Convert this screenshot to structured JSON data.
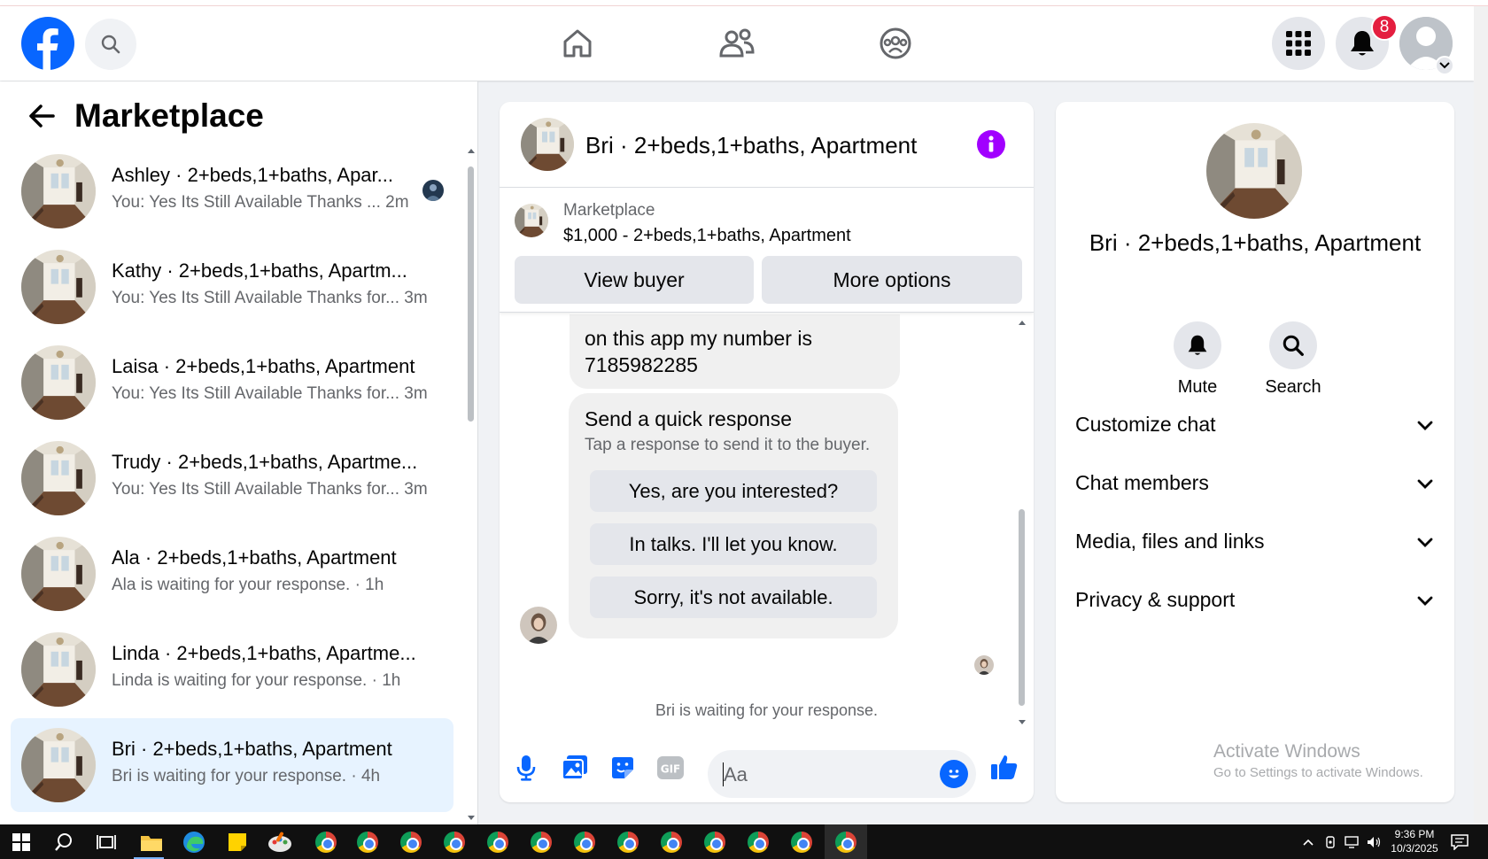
{
  "colors": {
    "facebook_blue": "#0866ff",
    "badge_red": "#e41e3f",
    "info_purple": "#a100ff",
    "active_row": "#e7f3ff"
  },
  "topbar": {
    "notification_count": "8",
    "icons": [
      "facebook-logo-icon",
      "search-icon",
      "home-icon",
      "friends-icon",
      "groups-icon",
      "menu-grid-icon",
      "bell-icon",
      "account-avatar"
    ]
  },
  "sidebar": {
    "title": "Marketplace",
    "conversations": [
      {
        "name": "Ashley · 2+beds,1+baths, Apar...",
        "preview": "You: Yes Its Still Available Thanks ...  2m",
        "seen": true,
        "active": false
      },
      {
        "name": "Kathy · 2+beds,1+baths, Apartm...",
        "preview": "You: Yes Its Still Available Thanks for... 3m",
        "seen": false,
        "active": false
      },
      {
        "name": "Laisa · 2+beds,1+baths, Apartment",
        "preview": "You: Yes Its Still Available Thanks for... 3m",
        "seen": false,
        "active": false
      },
      {
        "name": "Trudy · 2+beds,1+baths, Apartme...",
        "preview": "You: Yes Its Still Available Thanks for... 3m",
        "seen": false,
        "active": false
      },
      {
        "name": "Ala · 2+beds,1+baths, Apartment",
        "preview": "Ala is waiting for your response. · 1h",
        "seen": false,
        "active": false
      },
      {
        "name": "Linda · 2+beds,1+baths, Apartme...",
        "preview": "Linda is waiting for your response. · 1h",
        "seen": false,
        "active": false
      },
      {
        "name": "Bri · 2+beds,1+baths, Apartment",
        "preview": "Bri is waiting for your response. · 4h",
        "seen": false,
        "active": true
      }
    ]
  },
  "chat": {
    "title": "Bri · 2+beds,1+baths, Apartment",
    "listing_label": "Marketplace",
    "listing_price": "$1,000 - 2+beds,1+baths, Apartment",
    "view_buyer": "View buyer",
    "more_options": "More options",
    "message_line1": "on this app my number is",
    "message_line2": "7185982285",
    "quick_title": "Send a quick response",
    "quick_subtitle": "Tap a response to send it to the buyer.",
    "quick_replies": [
      "Yes, are you interested?",
      "In talks. I'll let you know.",
      "Sorry, it's not available."
    ],
    "waiting": "Bri is waiting for your response.",
    "input_placeholder": "Aa"
  },
  "details": {
    "name": "Bri · 2+beds,1+baths, Apartment",
    "mute": "Mute",
    "search": "Search",
    "sections": [
      "Customize chat",
      "Chat members",
      "Media, files and links",
      "Privacy & support"
    ]
  },
  "watermark": {
    "line1": "Activate Windows",
    "line2": "Go to Settings to activate Windows."
  },
  "taskbar": {
    "time": "9:36 PM",
    "date": "10/3/2025"
  }
}
